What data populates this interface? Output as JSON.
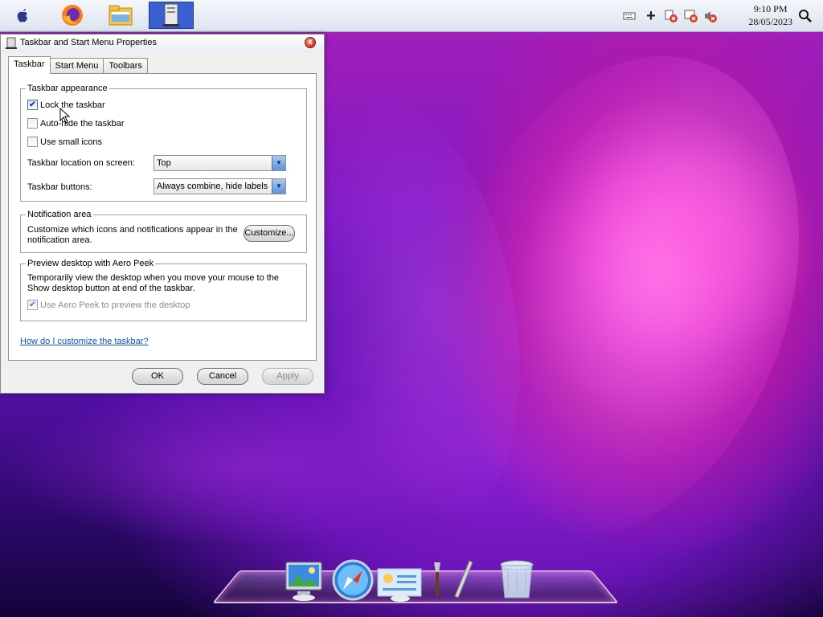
{
  "topbar": {
    "apps": [
      {
        "name": "apple-menu-icon",
        "glyph": ""
      },
      {
        "name": "firefox-icon"
      },
      {
        "name": "file-explorer-icon"
      },
      {
        "name": "taskbar-properties-app-icon"
      }
    ],
    "tray": [
      {
        "name": "keyboard-icon"
      },
      {
        "name": "add-icon"
      },
      {
        "name": "network-error-icon"
      },
      {
        "name": "network-error-icon-2"
      },
      {
        "name": "volume-muted-icon"
      }
    ],
    "clock": {
      "time": "9:10 PM",
      "date": "28/05/2023"
    }
  },
  "dialog": {
    "title": "Taskbar and Start Menu Properties",
    "close_glyph": "x",
    "tabs": [
      "Taskbar",
      "Start Menu",
      "Toolbars"
    ],
    "appearance": {
      "legend": "Taskbar appearance",
      "lock": {
        "label": "Lock the taskbar",
        "checked": true
      },
      "autohide": {
        "label": "Auto-hide the taskbar",
        "checked": false
      },
      "small_icons": {
        "label": "Use small icons",
        "checked": false
      },
      "location_label": "Taskbar location on screen:",
      "location_value": "Top",
      "buttons_label": "Taskbar buttons:",
      "buttons_value": "Always combine, hide labels"
    },
    "notification": {
      "legend": "Notification area",
      "desc": "Customize which icons and notifications appear in the notification area.",
      "customize_label": "Customize..."
    },
    "peek": {
      "legend": "Preview desktop with Aero Peek",
      "desc": "Temporarily view the desktop when you move your mouse to the Show desktop button at end of the taskbar.",
      "use_peek": {
        "label": "Use Aero Peek to preview the desktop",
        "checked": true
      }
    },
    "help_link": "How do I customize the taskbar?",
    "ok_label": "OK",
    "cancel_label": "Cancel",
    "apply_label": "Apply"
  },
  "dock": {
    "items": [
      "finder-icon",
      "safari-icon",
      "preview-icon",
      "brush-icon",
      "pen-icon",
      "trash-icon"
    ]
  }
}
